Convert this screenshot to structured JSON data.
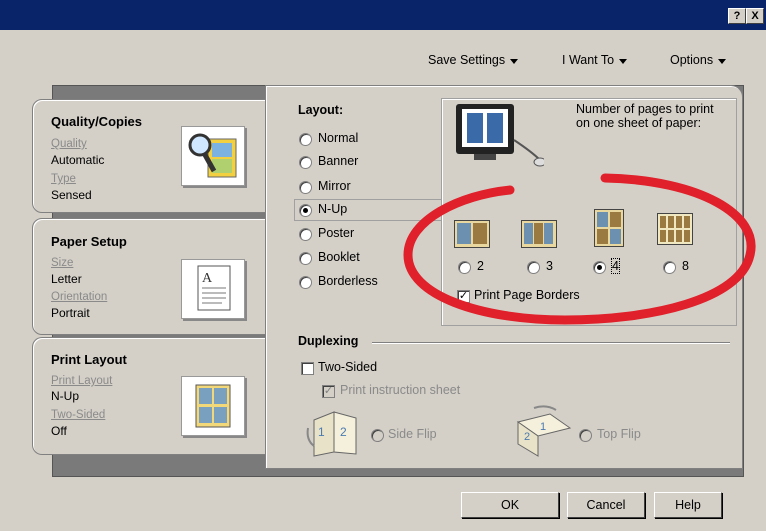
{
  "titlebar": {
    "help_label": "?",
    "close_label": "X"
  },
  "menu": {
    "save_settings": "Save Settings",
    "i_want_to": "I Want To",
    "options": "Options"
  },
  "tabs": {
    "quality": {
      "title": "Quality/Copies",
      "quality_label": "Quality",
      "quality_value": "Automatic",
      "type_label": "Type",
      "type_value": "Sensed"
    },
    "paper": {
      "title": "Paper Setup",
      "size_label": "Size",
      "size_value": "Letter",
      "orientation_label": "Orientation",
      "orientation_value": "Portrait"
    },
    "layout": {
      "title": "Print Layout",
      "print_layout_label": "Print Layout",
      "print_layout_value": "N-Up",
      "two_sided_label": "Two-Sided",
      "two_sided_value": "Off"
    }
  },
  "layout_group": {
    "title": "Layout:",
    "options": [
      "Normal",
      "Banner",
      "Mirror",
      "N-Up",
      "Poster",
      "Booklet",
      "Borderless"
    ],
    "selected": "N-Up"
  },
  "nup": {
    "description": "Number of pages to print on one sheet of paper:",
    "options": [
      "2",
      "3",
      "4",
      "8"
    ],
    "selected": "4",
    "print_borders_label": "Print Page Borders",
    "print_borders_checked": true
  },
  "duplexing": {
    "title": "Duplexing",
    "two_sided_label": "Two-Sided",
    "two_sided_checked": false,
    "instruction_label": "Print instruction sheet",
    "side_flip_label": "Side Flip",
    "top_flip_label": "Top Flip"
  },
  "buttons": {
    "ok": "OK",
    "cancel": "Cancel",
    "help": "Help"
  },
  "colors": {
    "titlebar": "#0a246a",
    "annotation": "#e0202a",
    "dialog": "#d4d0c8"
  }
}
